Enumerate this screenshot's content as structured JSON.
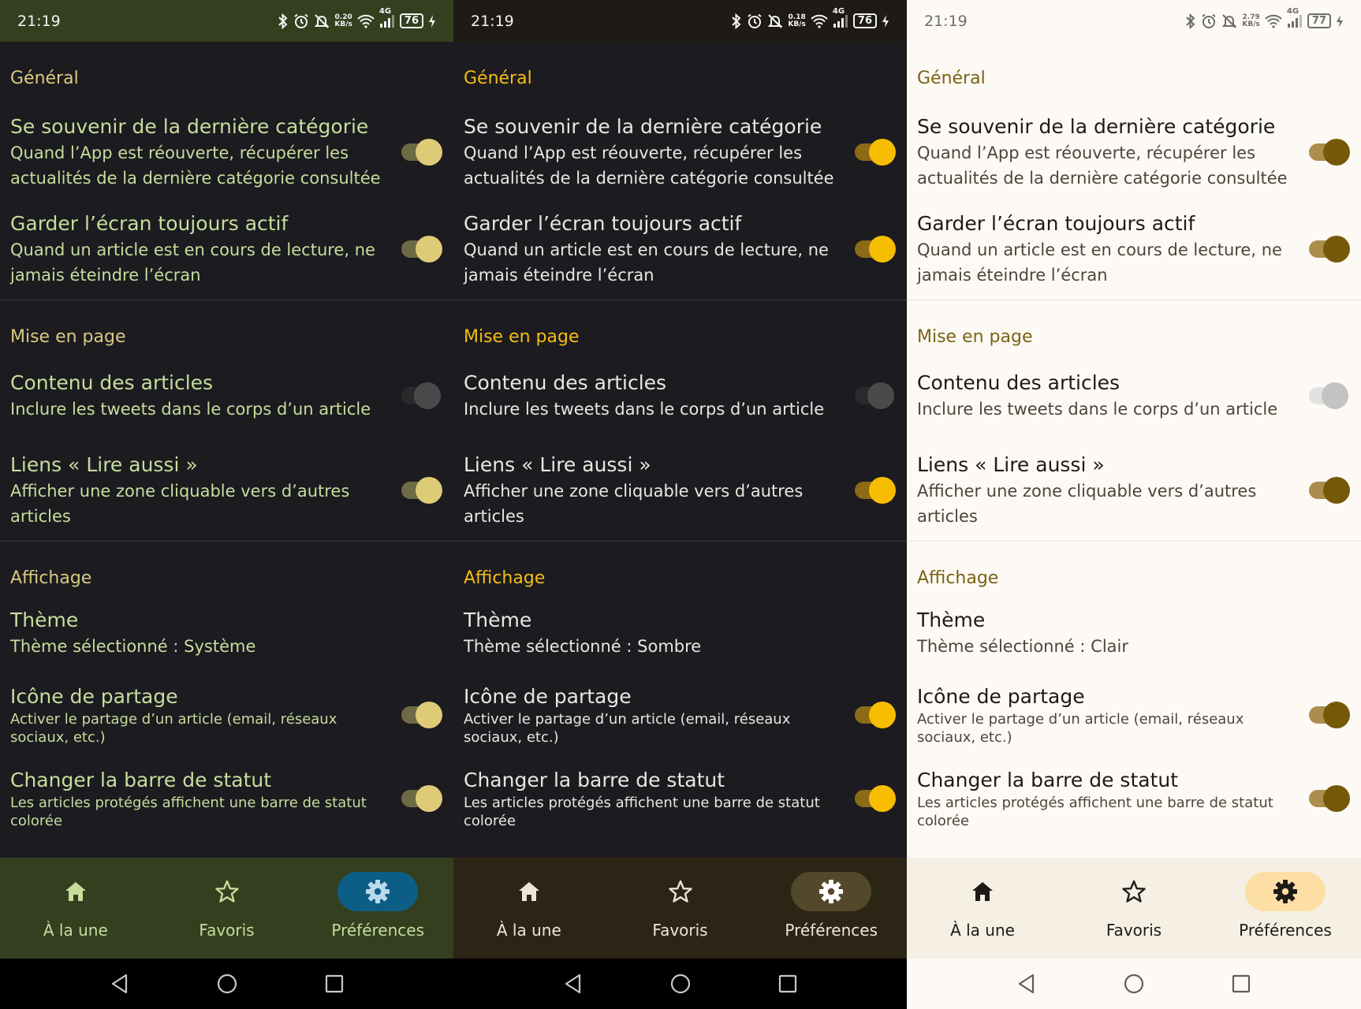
{
  "screens": [
    {
      "theme_name": "Système",
      "status": {
        "time": "21:19",
        "net_speed": "0.20",
        "net_unit": "KB/s",
        "network": "4G",
        "battery": "76"
      },
      "sections": [
        {
          "title": "Général",
          "rows": [
            {
              "title": "Se souvenir de la dernière catégorie",
              "sub": "Quand l’App est réouverte, récupérer les actualités de la dernière catégorie consultée",
              "toggle": true
            },
            {
              "title": "Garder l’écran toujours actif",
              "sub": "Quand un article est en cours de lecture, ne jamais éteindre l’écran",
              "toggle": true
            }
          ]
        },
        {
          "title": "Mise en page",
          "rows": [
            {
              "title": "Contenu des articles",
              "sub": "Inclure les tweets dans le corps d’un article",
              "toggle": false
            },
            {
              "title": "Liens « Lire aussi »",
              "sub": "Afficher une zone cliquable vers d’autres articles",
              "toggle": true
            }
          ]
        },
        {
          "title": "Affichage",
          "rows": [
            {
              "title": "Thème",
              "sub": "Thème sélectionné : Système"
            },
            {
              "title": "Icône de partage",
              "sub": "Activer le partage d’un article (email, réseaux sociaux, etc.)",
              "toggle": true
            },
            {
              "title": "Changer la barre de statut",
              "sub": "Les articles protégés affichent une barre de statut colorée",
              "toggle": true
            }
          ]
        }
      ],
      "nav": {
        "home": "À la une",
        "favorites": "Favoris",
        "preferences": "Préférences"
      }
    },
    {
      "theme_name": "Sombre",
      "status": {
        "time": "21:19",
        "net_speed": "0.18",
        "net_unit": "KB/s",
        "network": "4G",
        "battery": "76"
      },
      "sections": [
        {
          "title": "Général",
          "rows": [
            {
              "title": "Se souvenir de la dernière catégorie",
              "sub": "Quand l’App est réouverte, récupérer les actualités de la dernière catégorie consultée",
              "toggle": true
            },
            {
              "title": "Garder l’écran toujours actif",
              "sub": "Quand un article est en cours de lecture, ne jamais éteindre l’écran",
              "toggle": true
            }
          ]
        },
        {
          "title": "Mise en page",
          "rows": [
            {
              "title": "Contenu des articles",
              "sub": "Inclure les tweets dans le corps d’un article",
              "toggle": false
            },
            {
              "title": "Liens « Lire aussi »",
              "sub": "Afficher une zone cliquable vers d’autres articles",
              "toggle": true
            }
          ]
        },
        {
          "title": "Affichage",
          "rows": [
            {
              "title": "Thème",
              "sub": "Thème sélectionné : Sombre"
            },
            {
              "title": "Icône de partage",
              "sub": "Activer le partage d’un article (email, réseaux sociaux, etc.)",
              "toggle": true
            },
            {
              "title": "Changer la barre de statut",
              "sub": "Les articles protégés affichent une barre de statut colorée",
              "toggle": true
            }
          ]
        }
      ],
      "nav": {
        "home": "À la une",
        "favorites": "Favoris",
        "preferences": "Préférences"
      }
    },
    {
      "theme_name": "Clair",
      "status": {
        "time": "21:19",
        "net_speed": "2.79",
        "net_unit": "KB/s",
        "network": "4G",
        "battery": "77"
      },
      "sections": [
        {
          "title": "Général",
          "rows": [
            {
              "title": "Se souvenir de la dernière catégorie",
              "sub": "Quand l’App est réouverte, récupérer les actualités de la dernière catégorie consultée",
              "toggle": true
            },
            {
              "title": "Garder l’écran toujours actif",
              "sub": "Quand un article est en cours de lecture, ne jamais éteindre l’écran",
              "toggle": true
            }
          ]
        },
        {
          "title": "Mise en page",
          "rows": [
            {
              "title": "Contenu des articles",
              "sub": "Inclure les tweets dans le corps d’un article",
              "toggle": false
            },
            {
              "title": "Liens « Lire aussi »",
              "sub": "Afficher une zone cliquable vers d’autres articles",
              "toggle": true
            }
          ]
        },
        {
          "title": "Affichage",
          "rows": [
            {
              "title": "Thème",
              "sub": "Thème sélectionné : Clair"
            },
            {
              "title": "Icône de partage",
              "sub": "Activer le partage d’un article (email, réseaux sociaux, etc.)",
              "toggle": true
            },
            {
              "title": "Changer la barre de statut",
              "sub": "Les articles protégés affichent une barre de statut colorée",
              "toggle": true
            }
          ]
        }
      ],
      "nav": {
        "home": "À la une",
        "favorites": "Favoris",
        "preferences": "Préférences"
      }
    }
  ],
  "icons": {
    "status": [
      "bluetooth-icon",
      "alarm-icon",
      "mute-icon",
      "wifi-icon",
      "signal-icon",
      "battery-icon",
      "charging-icon"
    ],
    "nav": [
      "home-icon",
      "star-icon",
      "gear-icon"
    ],
    "system": [
      "back-icon",
      "home-circle-icon",
      "recents-icon"
    ]
  }
}
